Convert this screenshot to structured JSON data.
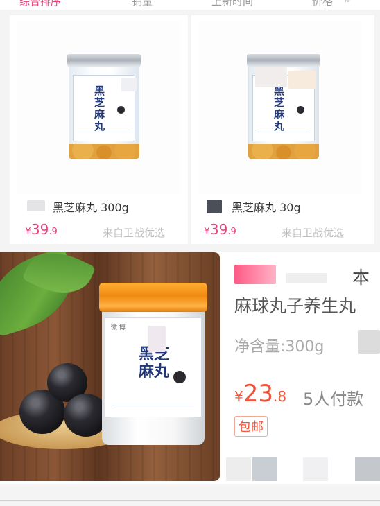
{
  "sort_tabs": [
    "综合排序",
    "销量",
    "上新时间",
    "价格"
  ],
  "products": [
    {
      "title": "黑芝麻丸 300g",
      "price_currency": "¥",
      "price_int": "39",
      "price_dec": ".9",
      "source": "来自卫战优选",
      "label_text": "黑芝麻丸"
    },
    {
      "title": "黑芝麻丸 30g",
      "price_currency": "¥",
      "price_int": "39",
      "price_dec": ".9",
      "source": "来自卫战优选",
      "label_text": "黑芝麻丸"
    }
  ],
  "featured": {
    "title_line1": "本",
    "title_line2": "麻球丸子养生丸",
    "spec": "净含量:300g",
    "price_currency": "¥",
    "price_int": "23",
    "price_dec": ".8",
    "paid_count": "5人付款",
    "badge": "包邮",
    "label_text": "黑芝麻丸"
  },
  "colors": {
    "accent_pink": "#e8437b",
    "price_red": "#f2533b",
    "muted": "#bdbdbd"
  }
}
